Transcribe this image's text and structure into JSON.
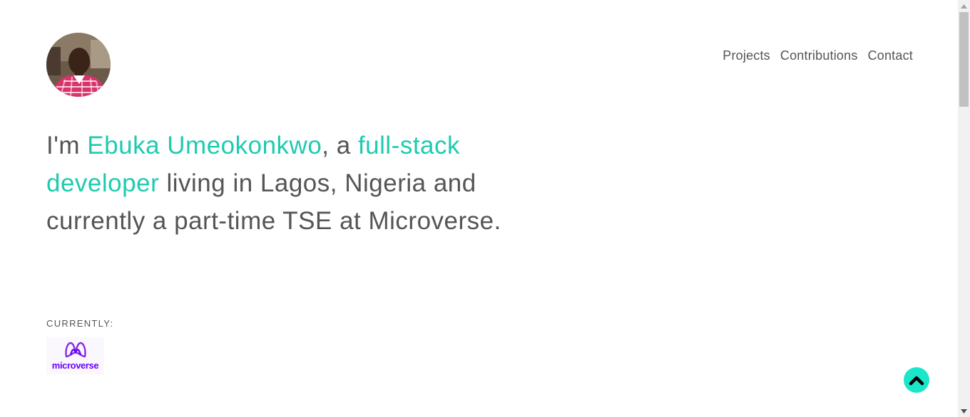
{
  "header": {
    "avatar_alt": "profile photo",
    "nav": [
      {
        "label": "Projects"
      },
      {
        "label": "Contributions"
      },
      {
        "label": "Contact"
      }
    ]
  },
  "hero": {
    "intro": "I'm ",
    "name": "Ebuka Umeokonkwo",
    "connector": ", a ",
    "role": "full-stack developer",
    "rest": " living in Lagos, Nigeria and currently a part-time TSE at Microverse."
  },
  "currently": {
    "label": "CURRENTLY:",
    "company_logo_text": "microverse"
  },
  "colors": {
    "accent": "#1ecbb0",
    "text": "#555555",
    "to_top_button": "#1be6c9",
    "microverse_purple": "#6a00ff"
  },
  "icons": {
    "to_top": "chevron-up-icon"
  }
}
